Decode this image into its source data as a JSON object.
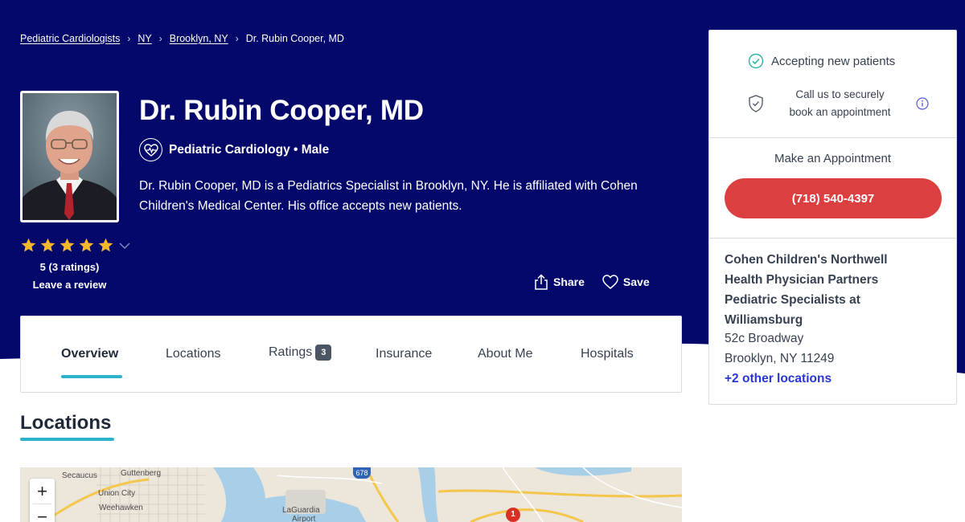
{
  "colors": {
    "hero_bg": "#04086b",
    "accent_underline": "#2bb3c9",
    "phone_button": "#dc3f3f",
    "link_blue": "#2936d6",
    "check_teal": "#2bb3a3",
    "star_gold": "#f6b828"
  },
  "breadcrumb": {
    "items": [
      "Pediatric Cardiologists",
      "NY",
      "Brooklyn, NY"
    ],
    "current": "Dr. Rubin Cooper, MD",
    "separator_icon": "chevron-right-icon"
  },
  "doctor": {
    "name": "Dr. Rubin Cooper, MD",
    "specialty": "Pediatric Cardiology • Male",
    "specialty_icon": "heart-pulse-icon",
    "bio": "Dr. Rubin Cooper, MD is a Pediatrics Specialist in Brooklyn, NY. He is affiliated with Cohen Children's Medical Center. His office accepts new patients.",
    "rating_value": 5,
    "rating_text": "5 (3 ratings)",
    "review_link": "Leave a review"
  },
  "actions": {
    "share": "Share",
    "save": "Save"
  },
  "tabs": [
    {
      "label": "Overview",
      "active": true
    },
    {
      "label": "Locations",
      "active": false
    },
    {
      "label": "Ratings",
      "badge": "3",
      "active": false
    },
    {
      "label": "Insurance",
      "active": false
    },
    {
      "label": "About Me",
      "active": false
    },
    {
      "label": "Hospitals",
      "active": false
    }
  ],
  "section": {
    "title": "Locations"
  },
  "map": {
    "labels": [
      "Secaucus",
      "Guttenberg",
      "Union City",
      "Weehawken",
      "LaGuardia",
      "Airport"
    ],
    "highway": "678",
    "pin": "1",
    "zoom_in": "+",
    "zoom_out": "−"
  },
  "sidebar": {
    "accepting": "Accepting new patients",
    "call_line1": "Call us to securely",
    "call_line2": "book an appointment",
    "make_appointment": "Make an Appointment",
    "phone": "(718) 540-4397",
    "practice_lines": [
      "Cohen Children's Northwell",
      "Health Physician Partners",
      "Pediatric Specialists at",
      "Williamsburg"
    ],
    "address_line1": "52c Broadway",
    "address_line2": "Brooklyn, NY 11249",
    "other_locations": "+2 other locations"
  }
}
